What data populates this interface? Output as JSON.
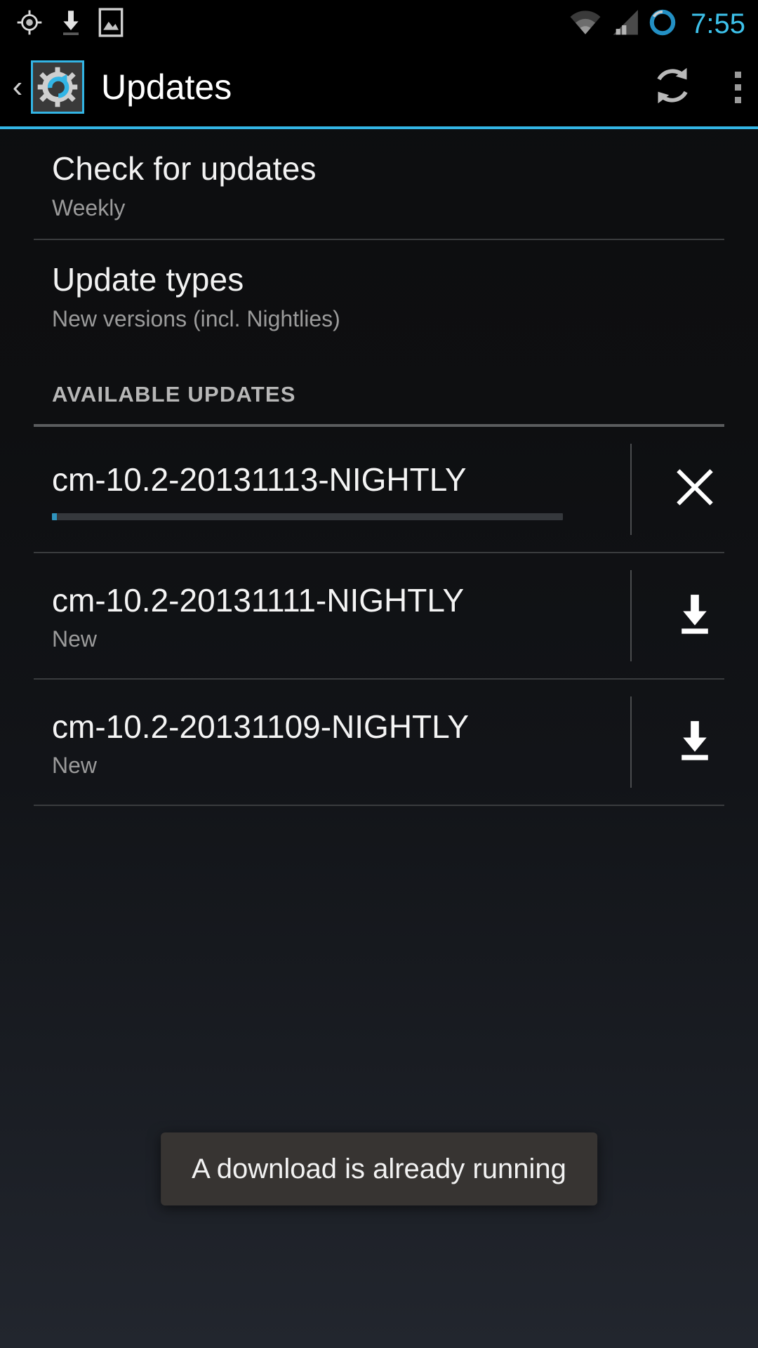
{
  "status_bar": {
    "icons": [
      "location-crosshair-icon",
      "download-icon",
      "image-icon",
      "wifi-icon",
      "cellular-signal-icon",
      "battery-circle-icon"
    ],
    "time": "7:55",
    "time_color": "#3dc1ea"
  },
  "action_bar": {
    "back_label": "‹",
    "app_icon": "updates-gear-icon",
    "title": "Updates",
    "refresh_icon": "refresh-icon",
    "overflow_icon": "overflow-menu-icon",
    "accent_color": "#33b5e5"
  },
  "preferences": [
    {
      "title": "Check for updates",
      "summary": "Weekly"
    },
    {
      "title": "Update types",
      "summary": "New versions (incl. Nightlies)"
    }
  ],
  "section": {
    "header": "AVAILABLE UPDATES"
  },
  "updates": [
    {
      "name": "cm-10.2-20131113-NIGHTLY",
      "status": "",
      "has_progress": true,
      "progress_percent": 1,
      "action_icon": "close-icon",
      "action_label": "Cancel download"
    },
    {
      "name": "cm-10.2-20131111-NIGHTLY",
      "status": "New",
      "has_progress": false,
      "progress_percent": 0,
      "action_icon": "download-icon",
      "action_label": "Download"
    },
    {
      "name": "cm-10.2-20131109-NIGHTLY",
      "status": "New",
      "has_progress": false,
      "progress_percent": 0,
      "action_icon": "download-icon",
      "action_label": "Download"
    }
  ],
  "toast": {
    "message": "A download is already running"
  }
}
